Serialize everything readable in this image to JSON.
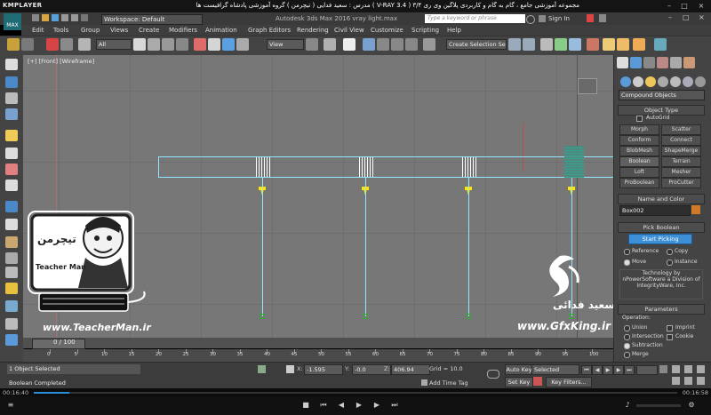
{
  "player": {
    "name": "KMPLAYER",
    "title": "مجموعه آموزشی جامع ، گام به گام و کاربردی پلاگین وی ری ۳/۴ ( V-RAY 3.4 )  مدرس : سعید فدایی ( تیچرمن ) گروه آموزشی پادشاه گرافیست ها",
    "current_time": "00:16:40",
    "total_time": "00:16:58"
  },
  "app": {
    "logo": "MAX",
    "workspace": "Workspace: Default",
    "title": "Autodesk 3ds Max 2016    vray light.max",
    "search_placeholder": "Type a keyword or phrase",
    "sign_in": "Sign In"
  },
  "menu": [
    "Edit",
    "Tools",
    "Group",
    "Views",
    "Create",
    "Modifiers",
    "Animation",
    "Graph Editors",
    "Rendering",
    "Civil View",
    "Customize",
    "Scripting",
    "Help"
  ],
  "toolbar": {
    "filter": "All",
    "ref_coord": "View",
    "named_sel": "Create Selection Se"
  },
  "viewport": {
    "label": "[+] [Front] [Wireframe]"
  },
  "overlay": {
    "teacherman_url": "www.TeacherMan.ir",
    "teacherman_logo": "تیچرمن",
    "teacherman_name": "Teacher Man",
    "gfx_url": "www.GfxKing.ir",
    "gfx_name": "سعید فدائی"
  },
  "command_panel": {
    "category": "Compound Objects",
    "object_type_header": "Object Type",
    "autogrid": "AutoGrid",
    "buttons": [
      "Morph",
      "Scatter",
      "Conform",
      "Connect",
      "BlobMesh",
      "ShapeMerge",
      "Boolean",
      "Terrain",
      "Loft",
      "Mesher",
      "ProBoolean",
      "ProCutter"
    ],
    "name_color_header": "Name and Color",
    "object_name": "Box002",
    "object_color": "#d07a28",
    "pick_boolean_header": "Pick Boolean",
    "start_picking": "Start Picking",
    "pick_options": [
      "Reference",
      "Copy",
      "Move",
      "Instance"
    ],
    "pick_selected": "Move",
    "tech_text": "Technology by nPowerSoftware a Division of IntegrityWare, Inc.",
    "parameters_header": "Parameters",
    "operation_label": "Operation:",
    "operations": [
      "Union",
      "Imprint",
      "Intersection",
      "Cookie",
      "Subtraction",
      "Merge"
    ],
    "operation_selected": "Subtraction"
  },
  "timeline": {
    "frame": "0 / 100",
    "ticks": [
      "0",
      "5",
      "10",
      "15",
      "20",
      "25",
      "30",
      "35",
      "40",
      "45",
      "50",
      "55",
      "60",
      "65",
      "70",
      "75",
      "80",
      "85",
      "90",
      "95",
      "100"
    ]
  },
  "status": {
    "selection": "1 Object Selected",
    "prompt": "Boolean Completed",
    "x_label": "X:",
    "x": "-1.595",
    "y_label": "Y:",
    "y": "-0.0",
    "z_label": "Z:",
    "z": "406.94",
    "grid": "Grid = 10.0",
    "add_time_tag": "Add Time Tag",
    "auto_key": "Auto Key",
    "set_key": "Set Key",
    "key_mode": "Selected",
    "key_filters": "Key Filters..."
  },
  "colors": {
    "accent": "#3d8fd6",
    "wire": "#8fe8ff",
    "light": "#ffe600"
  }
}
